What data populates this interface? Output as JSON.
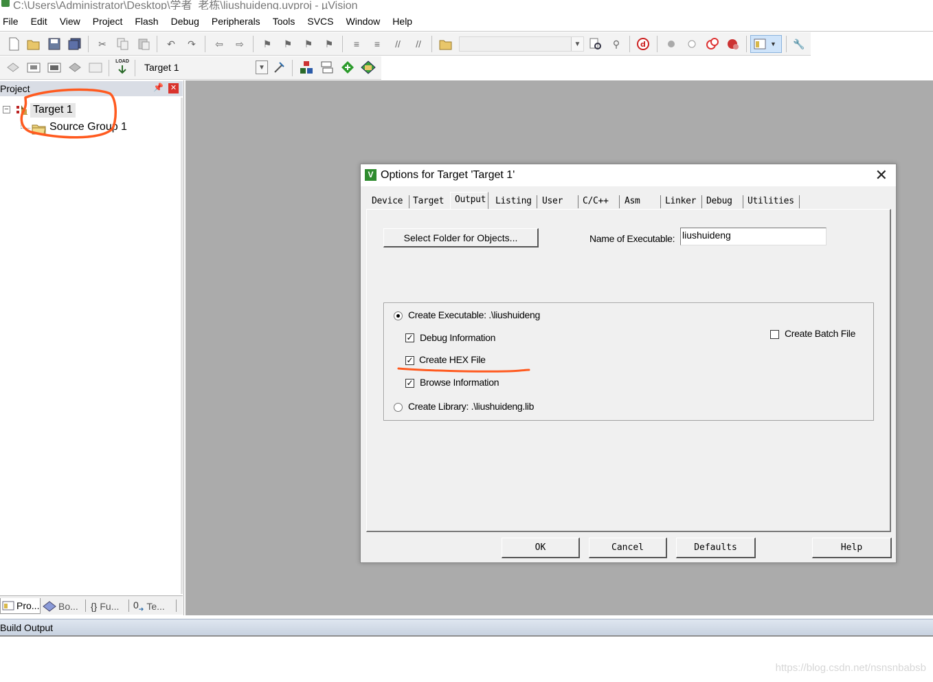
{
  "window": {
    "title": "C:\\Users\\Administrator\\Desktop\\学者_老栋\\liushuideng.uvproj - µVision"
  },
  "menu": [
    "File",
    "Edit",
    "View",
    "Project",
    "Flash",
    "Debug",
    "Peripherals",
    "Tools",
    "SVCS",
    "Window",
    "Help"
  ],
  "toolbar2": {
    "target_select": "Target 1",
    "load_label": "LOAD"
  },
  "project_panel": {
    "title": "Project",
    "tree": {
      "target": "Target 1",
      "group": "Source Group 1"
    },
    "bottom_tabs": [
      "Pro...",
      "Bo...",
      "Fu...",
      "Te..."
    ]
  },
  "build_output": {
    "title": "Build Output"
  },
  "watermark": "https://blog.csdn.net/nsnsnbabsb",
  "dialog": {
    "title": "Options for Target 'Target 1'",
    "tabs": [
      "Device",
      "Target",
      "Output",
      "Listing",
      "User",
      "C/C++",
      "Asm",
      "Linker",
      "Debug",
      "Utilities"
    ],
    "active_tab": "Output",
    "select_folder_button": "Select Folder for Objects...",
    "name_of_executable_label": "Name of Executable:",
    "name_of_executable_value": "liushuideng",
    "create_executable_label": "Create Executable:  .\\liushuideng",
    "create_executable_selected": true,
    "debug_information_label": "Debug Information",
    "debug_information_checked": true,
    "create_hex_label": "Create HEX File",
    "create_hex_checked": true,
    "browse_information_label": "Browse Information",
    "browse_information_checked": true,
    "create_library_label": "Create Library:  .\\liushuideng.lib",
    "create_library_selected": false,
    "create_batch_file_label": "Create Batch File",
    "create_batch_file_checked": false,
    "buttons": {
      "ok": "OK",
      "cancel": "Cancel",
      "defaults": "Defaults",
      "help": "Help"
    }
  },
  "colors": {
    "annotation": "#ff5a1f",
    "workspace": "#ababab",
    "dialog_bg": "#f0f0f0"
  }
}
